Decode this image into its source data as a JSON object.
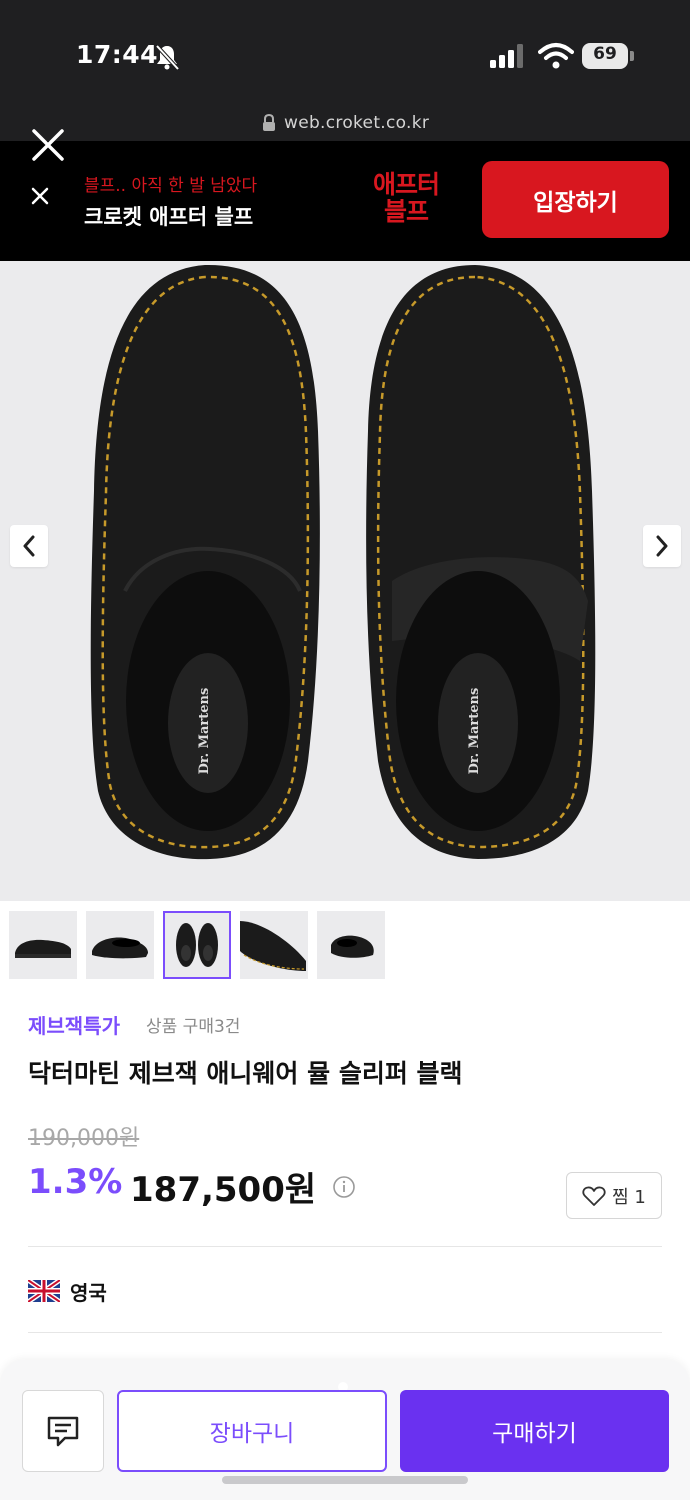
{
  "status_bar": {
    "time": "17:44",
    "battery": "69"
  },
  "browser": {
    "url": "web.croket.co.kr"
  },
  "promo_banner": {
    "subtitle": "블프.. 아직 한 발 남았다",
    "title": "크로켓 애프터 블프",
    "logo_line1": "애프터",
    "logo_line2": "블프",
    "button_label": "입장하기",
    "accent_color": "#d8171f"
  },
  "product": {
    "brand_tag": "제브잭특가",
    "purchase_count": "상품 구매3건",
    "title": "닥터마틴 제브잭 애니웨어 뮬 슬리퍼 블랙",
    "original_price": "190,000원",
    "discount_rate": "1.3%",
    "sale_price": "187,500원",
    "wish_label": "찜 1",
    "origin": "영국",
    "thumbnail_count": 5,
    "selected_thumbnail": 3,
    "accent_color": "#7b4dfc"
  },
  "bottom_bar": {
    "cart_label": "장바구니",
    "buy_label": "구매하기"
  },
  "icons": [
    "bell-muted-icon",
    "signal-icon",
    "wifi-icon",
    "battery-icon",
    "lock-icon",
    "close-icon",
    "chevron-left-icon",
    "chevron-right-icon",
    "info-icon",
    "heart-icon",
    "uk-flag-icon",
    "chat-icon"
  ]
}
